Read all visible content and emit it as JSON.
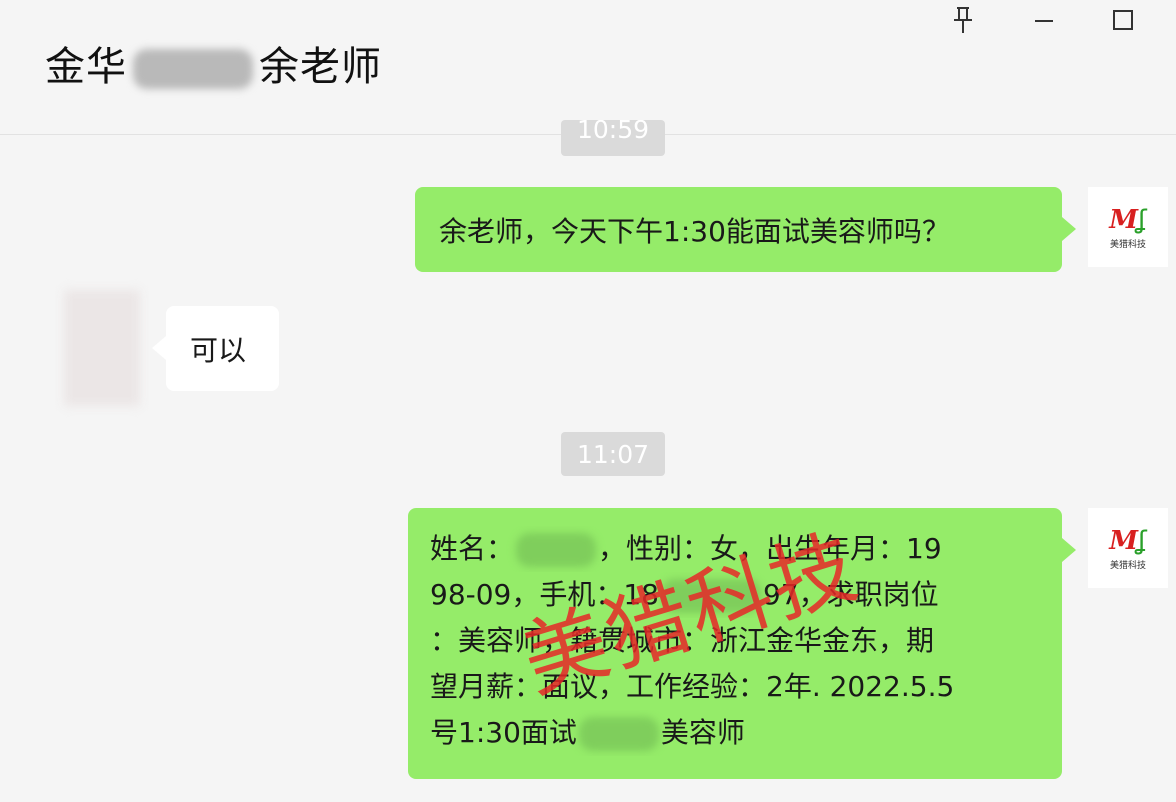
{
  "header": {
    "title_prefix": "金华",
    "title_suffix": "余老师"
  },
  "window_controls": {
    "pin_icon": "pin-icon",
    "minimize_icon": "minimize-icon",
    "maximize_icon": "maximize-icon"
  },
  "timestamps": {
    "top": "10:59",
    "middle": "11:07"
  },
  "messages": {
    "m1": "余老师，今天下午1:30能面试美容师吗？",
    "m2": "可以",
    "m3": {
      "l1a": "姓名：",
      "l1b": "，性别：女，出生年月：19",
      "l2a": "98-09，手机：18",
      "l2b": "97，求职岗位",
      "l3": "：美容师，籍贯城市：浙江金华金东，期",
      "l4": "望月薪：面议，工作经验：2年. 2022.5.5",
      "l5a": "号1:30面试",
      "l5b": "美容师"
    }
  },
  "watermark": "美猎科技",
  "colors": {
    "background": "#f5f5f5",
    "bubble_green": "#95ec69",
    "bubble_white": "#ffffff",
    "watermark_red": "#e62828"
  }
}
